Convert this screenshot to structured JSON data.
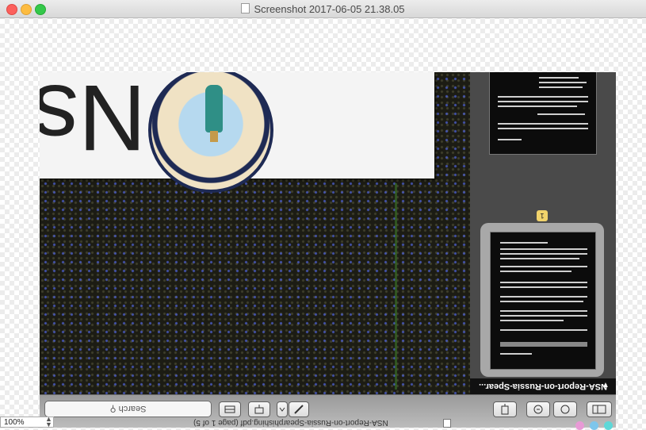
{
  "window": {
    "title": "Screenshot 2017-06-05 21.38.05"
  },
  "preview": {
    "document_title": "NSA-Report-on-Russia-Spear...",
    "status_text": "NSA-Report-on-Russia-Spearphishing.pdf (page 1 of 5)",
    "page_badge": "1",
    "big_glyph": "Ns",
    "search": {
      "label": "Search"
    }
  },
  "zoom": {
    "value": "100%"
  },
  "colors": {
    "close": "#fc605c",
    "minimize": "#fdbc40",
    "maximize": "#34c84a",
    "page_badge": "#f1d36b",
    "tag_pink": "#e89ad6",
    "tag_blue": "#7ec6ec",
    "tag_cyan": "#5ed8d8"
  },
  "icons": {
    "doc": "document-icon",
    "search": "magnifier-icon",
    "sidebar": "sidebar-toggle-icon"
  }
}
